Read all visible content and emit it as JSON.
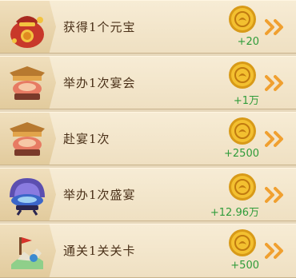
{
  "tasks": [
    {
      "title": "获得1个元宝",
      "reward": "+20",
      "icon": "lucky-bag-icon"
    },
    {
      "title": "举办1次宴会",
      "reward": "+1万",
      "icon": "banquet-table-icon"
    },
    {
      "title": "赴宴1次",
      "reward": "+2500",
      "icon": "banquet-table-icon"
    },
    {
      "title": "举办1次盛宴",
      "reward": "+12.96万",
      "icon": "grand-banquet-icon"
    },
    {
      "title": "通关1关关卡",
      "reward": "+500",
      "icon": "battle-stage-icon"
    }
  ],
  "colors": {
    "reward_text": "#2f9c3a",
    "title_text": "#4a3018",
    "coin": "#f0b020",
    "arrow": "#f0a030"
  }
}
